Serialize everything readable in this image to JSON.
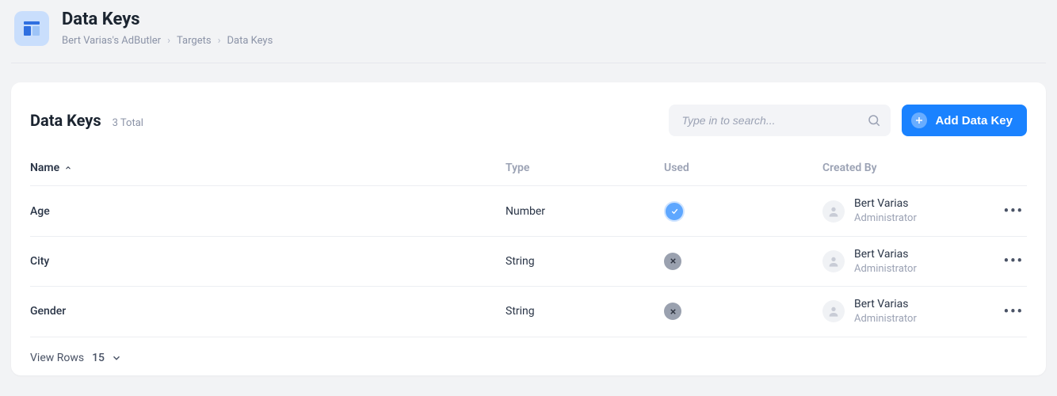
{
  "header": {
    "title": "Data Keys",
    "breadcrumbs": [
      "Bert Varias's AdButler",
      "Targets",
      "Data Keys"
    ]
  },
  "card": {
    "title": "Data Keys",
    "count_label": "3 Total",
    "search_placeholder": "Type in to search...",
    "add_button_label": "Add Data Key"
  },
  "table": {
    "columns": {
      "name": "Name",
      "type": "Type",
      "used": "Used",
      "created_by": "Created By"
    },
    "rows": [
      {
        "name": "Age",
        "type": "Number",
        "used": true,
        "created_by": {
          "name": "Bert Varias",
          "role": "Administrator"
        }
      },
      {
        "name": "City",
        "type": "String",
        "used": false,
        "created_by": {
          "name": "Bert Varias",
          "role": "Administrator"
        }
      },
      {
        "name": "Gender",
        "type": "String",
        "used": false,
        "created_by": {
          "name": "Bert Varias",
          "role": "Administrator"
        }
      }
    ]
  },
  "footer": {
    "view_rows_label": "View Rows",
    "rows_value": "15"
  }
}
